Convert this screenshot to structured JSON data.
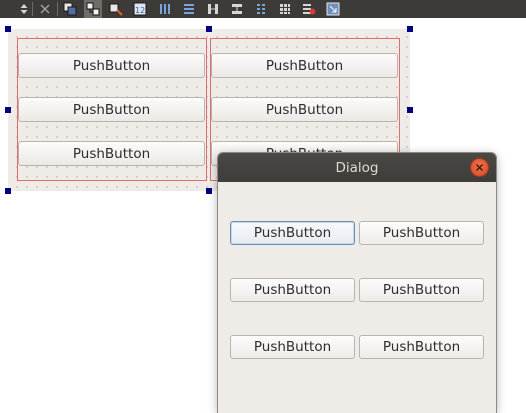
{
  "toolbar": {
    "icons": [
      "move-handle-icon",
      "break-layout-icon",
      "edit-widgets-icon",
      "edit-signals-slots-icon",
      "edit-buddies-icon",
      "edit-tab-order-icon",
      "layout-horizontal-icon",
      "layout-vertical-icon",
      "layout-horizontal-splitter-icon",
      "layout-vertical-splitter-icon",
      "layout-form-icon",
      "layout-grid-icon",
      "break-layout-icon",
      "adjust-size-icon"
    ]
  },
  "designer": {
    "buttons": [
      {
        "label": "PushButton"
      },
      {
        "label": "PushButton"
      },
      {
        "label": "PushButton"
      },
      {
        "label": "PushButton"
      },
      {
        "label": "PushButton"
      },
      {
        "label": "PushButton"
      }
    ],
    "colors": {
      "layout_frame": "#e06d6d",
      "handle": "#000080",
      "canvas": "#efebe7"
    }
  },
  "dialog": {
    "title": "Dialog",
    "buttons": [
      {
        "label": "PushButton"
      },
      {
        "label": "PushButton"
      },
      {
        "label": "PushButton"
      },
      {
        "label": "PushButton"
      },
      {
        "label": "PushButton"
      },
      {
        "label": "PushButton"
      }
    ],
    "colors": {
      "titlebar": "#3e3d39",
      "close": "#e0532c"
    }
  }
}
